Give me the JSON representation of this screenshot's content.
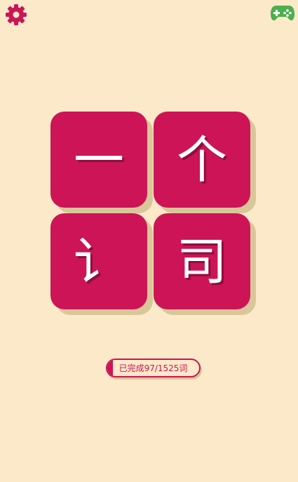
{
  "toolbar": {
    "settings_icon": "gear-icon",
    "games_icon": "gamepad-icon"
  },
  "colors": {
    "background": "#fbe9c9",
    "tile": "#cc1456",
    "games_icon": "#4caf50"
  },
  "puzzle": {
    "tiles": [
      "一",
      "个",
      "讠",
      "司"
    ]
  },
  "progress": {
    "label": "已完成97/1525词",
    "fraction": 0.0636
  }
}
